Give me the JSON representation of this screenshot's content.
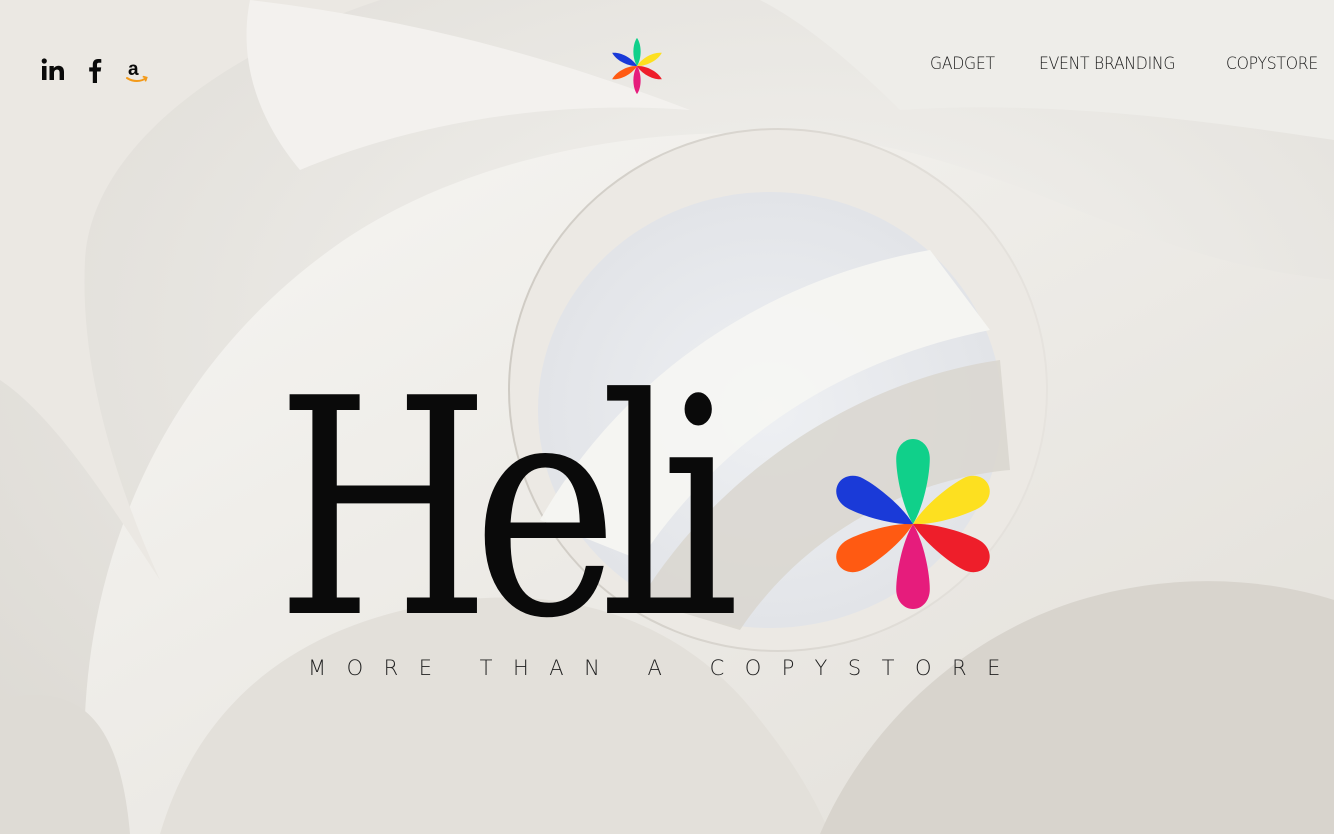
{
  "social": {
    "items": [
      {
        "name": "linkedin",
        "icon": "linkedin-icon"
      },
      {
        "name": "facebook",
        "icon": "facebook-icon"
      },
      {
        "name": "amazon",
        "icon": "amazon-icon"
      }
    ]
  },
  "header": {
    "logo_icon": "flower-logo-icon",
    "nav": [
      {
        "label": "GADGET"
      },
      {
        "label": "EVENT BRANDING"
      },
      {
        "label": "COPYSTORE"
      }
    ]
  },
  "hero": {
    "brand_word": "Heli",
    "brand_mark_icon": "flower-asterisk-icon",
    "tagline": "MORE THAN A COPYSTORE"
  },
  "colors": {
    "petal_green": "#10d08a",
    "petal_yellow": "#fde020",
    "petal_red": "#ee1e2a",
    "petal_pink": "#e61c7c",
    "petal_orange": "#ff5a12",
    "petal_blue": "#1a3ad8",
    "text": "#0a0a0a"
  }
}
